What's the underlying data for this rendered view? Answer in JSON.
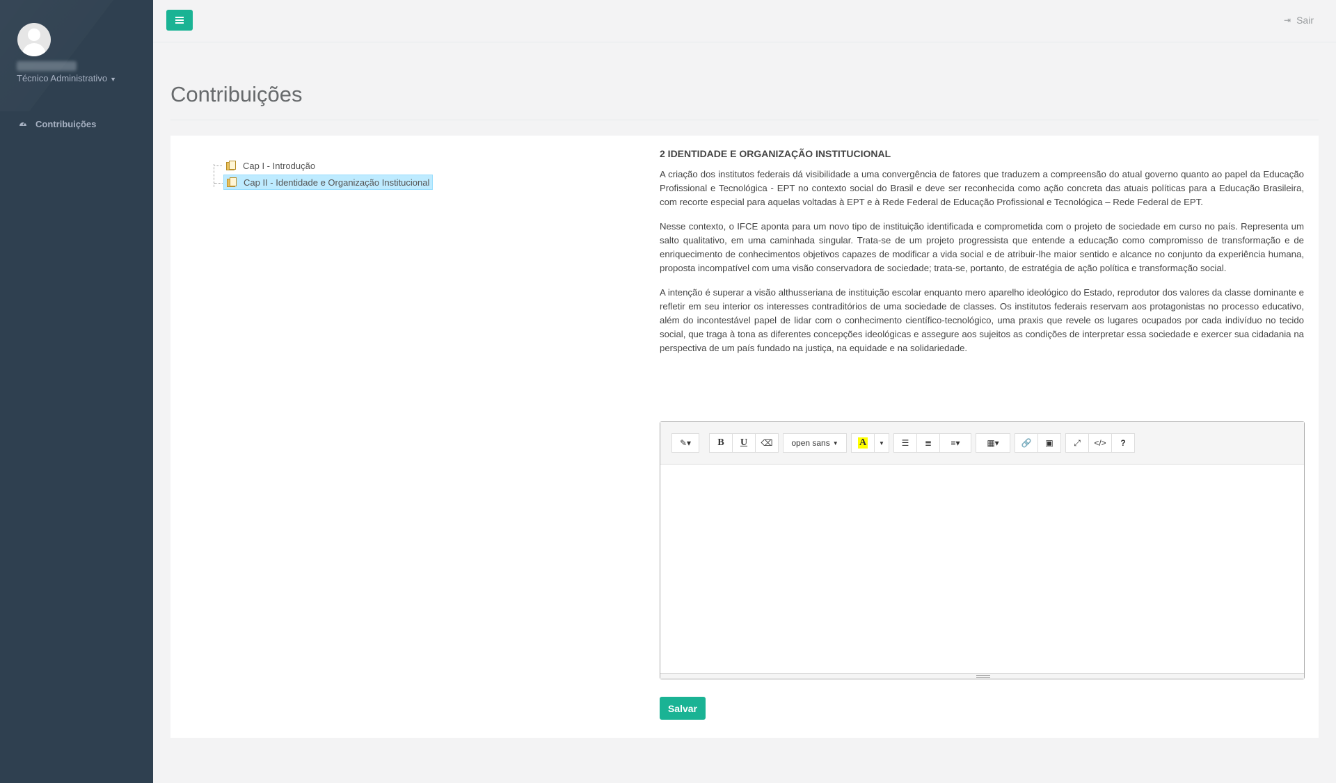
{
  "sidebar": {
    "user_role": "Técnico Administrativo",
    "nav_items": [
      {
        "label": "Contribuições",
        "icon": "dashboard-icon"
      }
    ]
  },
  "topbar": {
    "logout_label": "Sair"
  },
  "page": {
    "title": "Contribuições"
  },
  "tree": {
    "nodes": [
      {
        "label": "Cap I - Introdução",
        "selected": false
      },
      {
        "label": "Cap II - Identidade e Organização Institucional",
        "selected": true
      }
    ]
  },
  "document": {
    "heading": "2 IDENTIDADE E ORGANIZAÇÃO INSTITUCIONAL",
    "paragraphs": [
      "A criação dos institutos federais dá visibilidade a uma convergência de fatores que traduzem a compreensão do atual governo quanto ao papel da Educação Profissional e Tecnológica - EPT no contexto social do Brasil e deve ser reconhecida como ação concreta das atuais políticas para a Educação Brasileira, com recorte especial para aquelas voltadas à EPT e à Rede Federal de Educação Profissional e Tecnológica – Rede Federal de EPT.",
      "Nesse contexto, o IFCE aponta para um novo tipo de instituição identificada e comprometida com o projeto de sociedade em curso no país. Representa um salto qualitativo, em uma caminhada singular. Trata-se de um projeto progressista que entende a educação como compromisso de transformação e de enriquecimento de conhecimentos objetivos capazes de modificar a vida social e de atribuir-lhe maior sentido e alcance no conjunto da experiência humana, proposta incompatível com uma visão conservadora de sociedade; trata-se, portanto, de estratégia de ação política e transformação social.",
      "A intenção é superar a visão althusseriana de instituição escolar enquanto mero aparelho ideológico do Estado, reprodutor dos valores da classe dominante e refletir em seu interior os interesses contraditórios de uma sociedade de classes. Os institutos federais reservam aos protagonistas no processo educativo, além do incontestável papel de lidar com o conhecimento científico-tecnológico, uma praxis que revele os lugares ocupados por cada indivíduo no tecido social, que traga à tona as diferentes concepções ideológicas e assegure aos sujeitos as condições de interpretar essa sociedade e exercer sua cidadania na perspectiva de um país fundado na justiça, na equidade e na solidariedade."
    ]
  },
  "editor": {
    "font_name": "open sans",
    "content": "",
    "highlight_color": "#ffff00"
  },
  "actions": {
    "save_label": "Salvar"
  },
  "colors": {
    "accent": "#1ab394",
    "sidebar": "#2f4050",
    "tree_selected": "#beebff"
  }
}
